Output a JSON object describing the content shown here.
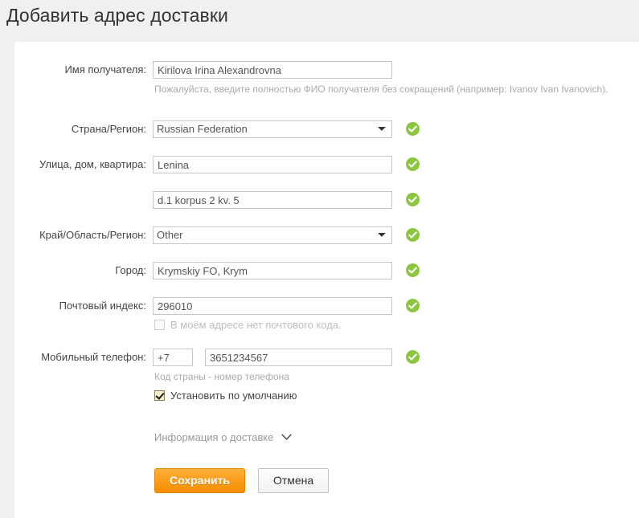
{
  "page": {
    "title": "Добавить адрес доставки"
  },
  "form": {
    "recipient": {
      "label": "Имя получателя:",
      "value": "Kirilova Irina Alexandrovna",
      "hint": "Пожалуйста, введите полностью ФИО получателя без сокращений (например: Ivanov Ivan Ivanovich)."
    },
    "country": {
      "label": "Страна/Регион:",
      "value": "Russian Federation",
      "options": [
        "Russian Federation"
      ],
      "valid": true
    },
    "street": {
      "label": "Улица, дом, квартира:",
      "value": "Lenina",
      "valid": true
    },
    "street2": {
      "label": "",
      "value": "d.1 korpus 2 kv. 5",
      "valid": true
    },
    "region": {
      "label": "Край/Область/Регион:",
      "value": "Other",
      "options": [
        "Other"
      ],
      "valid": true
    },
    "city": {
      "label": "Город:",
      "value": "Krymskiy FO, Krym",
      "valid": true
    },
    "zip": {
      "label": "Почтовый индекс:",
      "value": "296010",
      "valid": true,
      "no_zip_checkbox_label": "В моём адресе нет почтового кода.",
      "no_zip_checked": false
    },
    "phone": {
      "label": "Мобильный телефон:",
      "country_code": "+7",
      "number": "3651234567",
      "hint": "Код страны - номер телефона",
      "valid": true
    },
    "default_address": {
      "label": "Установить по умолчанию",
      "checked": true
    },
    "shipping_info": {
      "label": "Информация о доставке"
    }
  },
  "actions": {
    "save_label": "Сохранить",
    "cancel_label": "Отмена"
  },
  "colors": {
    "accent_orange": "#f89406",
    "valid_green": "#8cc63f",
    "page_background": "#f0f0f0",
    "card_background": "#ffffff"
  }
}
